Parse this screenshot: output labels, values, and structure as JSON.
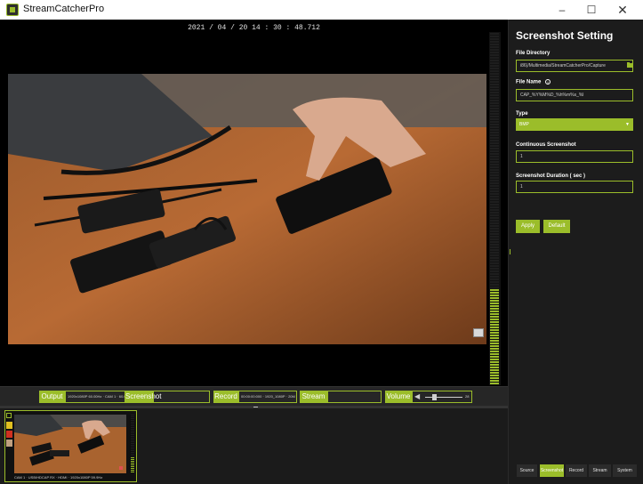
{
  "window": {
    "title": "StreamCatcherPro",
    "minimize": "–",
    "maximize": "☐",
    "close": "✕"
  },
  "video": {
    "timestamp": "2021 / 04 / 20   14 : 30 : 48.712"
  },
  "status_bar": {
    "output_label": "Output",
    "output_value": "1920x1080P 60.00Hz · CAM 1 · 60.07Hz",
    "screenshot_label": "Screenshot",
    "record_label": "Record",
    "record_value": "00:00:00:000 · 1920_1080P · 20M MP4",
    "stream_label": "Stream",
    "volume_label": "Volume",
    "volume_value": "28"
  },
  "thumbnail": {
    "caption": "CAM 1 · USB/HDCAP RX · HDMI · 1920x1080P 59.9Hz"
  },
  "settings": {
    "title": "Screenshot Setting",
    "file_directory_label": "File Directory",
    "file_directory_value": "i86)/Multimedia/StreamCatcherPro/Capture",
    "file_name_label": "File Name",
    "file_name_info": "i",
    "file_name_value": "CAP_%Y%M%D_%h%m%s_%l",
    "type_label": "Type",
    "type_value": "BMP",
    "continuous_label": "Continuous Screenshot",
    "continuous_value": "1",
    "duration_label": "Screenshot Duration ( sec )",
    "duration_value": "1",
    "apply_label": "Apply",
    "default_label": "Default"
  },
  "tabs": [
    {
      "label": "Source"
    },
    {
      "label": "Screenshot"
    },
    {
      "label": "Record"
    },
    {
      "label": "Stream"
    },
    {
      "label": "System"
    }
  ],
  "colors": {
    "accent": "#9bbd2a",
    "background": "#1c1c1c",
    "video_background": "#000000"
  },
  "meter": {
    "level": 0.27
  }
}
